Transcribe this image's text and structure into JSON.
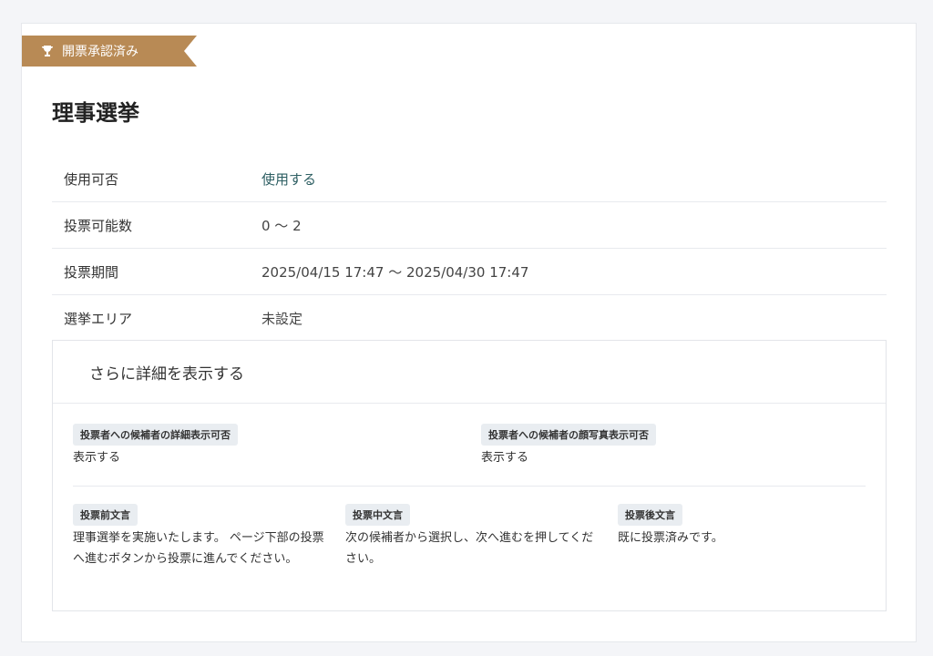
{
  "badge": {
    "label": "開票承認済み",
    "icon": "trophy-icon"
  },
  "title": "理事選挙",
  "info": [
    {
      "label": "使用可否",
      "value": "使用する"
    },
    {
      "label": "投票可能数",
      "value": "0 ～ 2"
    },
    {
      "label": "投票期間",
      "value": "2025/04/15 17:47 ～ 2025/04/30 17:47"
    },
    {
      "label": "選挙エリア",
      "value": "未設定"
    }
  ],
  "details": {
    "toggle_label": "さらに詳細を表示する",
    "detail_display": {
      "label": "投票者への候補者の詳細表示可否",
      "value": "表示する"
    },
    "photo_display": {
      "label": "投票者への候補者の顔写真表示可否",
      "value": "表示する"
    },
    "pre_text": {
      "label": "投票前文言",
      "value": "理事選挙を実施いたします。 ページ下部の投票へ進むボタンから投票に進んでください。"
    },
    "mid_text": {
      "label": "投票中文言",
      "value": "次の候補者から選択し、次へ進むを押してください。"
    },
    "post_text": {
      "label": "投票後文言",
      "value": "既に投票済みです。"
    }
  },
  "colors": {
    "ribbon": "#b88a55",
    "accent_value": "#2e5f63",
    "tag_bg": "#e9edf1"
  }
}
